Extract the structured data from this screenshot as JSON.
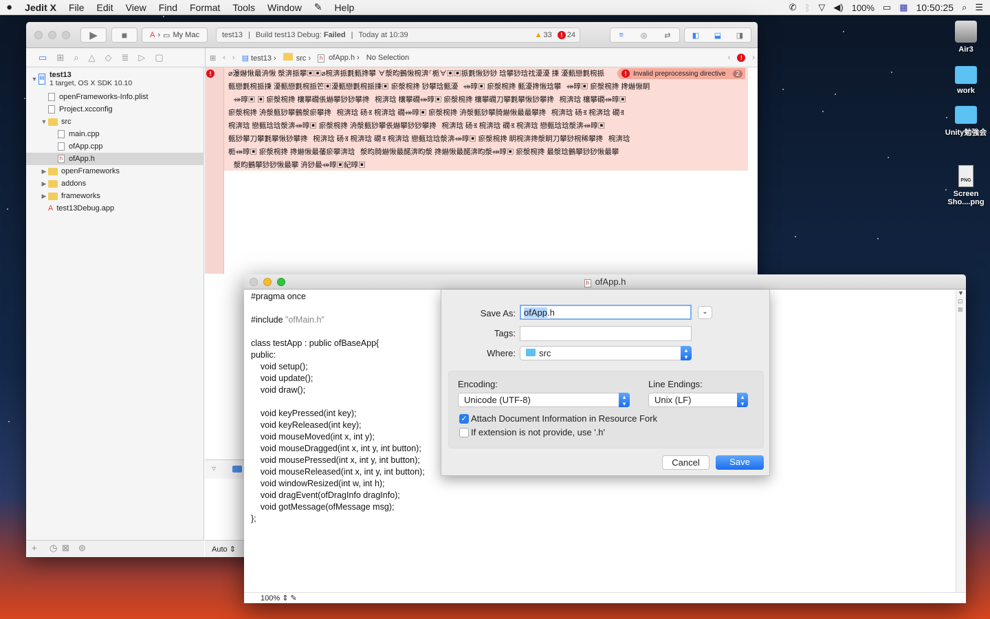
{
  "menubar": {
    "app": "Jedit X",
    "items": [
      "File",
      "Edit",
      "View",
      "Find",
      "Format",
      "Tools",
      "Window",
      "Help"
    ],
    "battery": "100%",
    "clock": "10:50:25"
  },
  "desktop": {
    "icons": [
      "Air3",
      "work",
      "Unity勉強会",
      "Screen Sho....png"
    ],
    "png_badge": "PNG"
  },
  "xcode": {
    "scheme": "My Mac",
    "status": {
      "project": "test13",
      "build_prefix": "Build test13 Debug:",
      "build_result": "Failed",
      "time": "Today at 10:39",
      "warnings": "33",
      "errors": "24"
    },
    "breadcrumb": [
      "test13",
      "src",
      "ofApp.h",
      "No Selection"
    ],
    "tree": [
      {
        "label": "test13",
        "sub": "1 target, OS X SDK 10.10",
        "level": 0,
        "type": "project",
        "open": true
      },
      {
        "label": "openFrameworks-Info.plist",
        "level": 1,
        "type": "file"
      },
      {
        "label": "Project.xcconfig",
        "level": 1,
        "type": "file"
      },
      {
        "label": "src",
        "level": 1,
        "type": "folder",
        "open": true
      },
      {
        "label": "main.cpp",
        "level": 2,
        "type": "file"
      },
      {
        "label": "ofApp.cpp",
        "level": 2,
        "type": "file"
      },
      {
        "label": "ofApp.h",
        "level": 2,
        "type": "file",
        "selected": true
      },
      {
        "label": "openFrameworks",
        "level": 1,
        "type": "folder",
        "open": false
      },
      {
        "label": "addons",
        "level": 1,
        "type": "folder",
        "open": false
      },
      {
        "label": "frameworks",
        "level": 1,
        "type": "folder",
        "open": false
      },
      {
        "label": "test13Debug.app",
        "level": 1,
        "type": "app"
      }
    ],
    "error_message": "Invalid preprocessing directive",
    "error_count": "2",
    "garbled_lines": [
      "⌀瀑爀愀最洀愀  漀渀挀攀▣▣⌀椀渀挀氀甀搀攀  ∀漀昀䴀愀椀渀⸀栀∀▣▣挀氀愀猀猀  琀攀猀琀䄀瀀瀀  㨀  瀀甀戀氀椀挀",
      "    甀戀氀椀挀㨀  瀀甀戀氀椀挀笀▣瀀甀戀氀椀挀㨀▣      瘀漀椀搀  猀攀琀甀瀀⠀⤀㬀▣      瘀漀椀搀  甀瀀搀愀琀攀⠀⤀㬀▣      瘀漀椀搀  搀爀愀眀",
      "    ⠀⤀㬀▣      ▣      瘀漀椀搀  欀攀礀倀爀攀猀猀攀搀⠀椀渀琀  欀攀礀⤀㬀▣      瘀漀椀搀  欀攀礀刀攀氀攀愀猀攀搀⠀椀渀琀  欀攀礀⤀㬀▣",
      "    瘀漀椀搀  洀漀甀猀攀䴀漀瘀攀搀⠀椀渀琀  砀Ⱐ  椀渀琀  礀⤀㬀▣      瘀漀椀搀  洀漀甀猀攀䐀爀愀最最攀搀⠀椀渀琀  砀Ⱐ  椀渀琀  礀Ⱐ",
      "    椀渀琀  戀甀琀琀漀渀⤀㬀▣      瘀漀椀搀  洀漀甀猀攀倀爀攀猀猀攀搀⠀椀渀琀  砀Ⱐ  椀渀琀  礀Ⱐ  椀渀琀  戀甀琀琀漀渀⤀㬀▣",
      "    甀猀攀刀攀氀攀愀猀攀搀⠀椀渀琀  砀Ⱐ  椀渀琀  礀Ⱐ  椀渀琀  戀甀琀琀漀渀⤀㬀▣      瘀漀椀搀  眀椀渀搀漀眀刀攀猀椀稀攀搀⠀椀渀琀",
      "    栀⤀㬀▣      瘀漀椀搀  搀爀愀最䔀瘀攀渀琀⠀漀昀䐀爀愀最䤀渀昀漀  搀爀愀最䤀渀昀漀⤀㬀▣      瘀漀椀搀  最漀琀䴀攀猀猀愀最攀",
      "    ⠀漀昀䴀攀猀猀愀最攀  洀猀最⤀㬀▣紀㬀▣"
    ],
    "bottom_mode": "Auto"
  },
  "jedit": {
    "title": "ofApp.h",
    "code": [
      {
        "t": "#pragma once"
      },
      {
        "t": ""
      },
      {
        "t": "#include ",
        "s": "\"ofMain.h\""
      },
      {
        "t": ""
      },
      {
        "t": "class testApp : public ofBaseApp{"
      },
      {
        "t": "public:"
      },
      {
        "t": "    void setup();"
      },
      {
        "t": "    void update();"
      },
      {
        "t": "    void draw();"
      },
      {
        "t": ""
      },
      {
        "t": "    void keyPressed(int key);"
      },
      {
        "t": "    void keyReleased(int key);"
      },
      {
        "t": "    void mouseMoved(int x, int y);"
      },
      {
        "t": "    void mouseDragged(int x, int y, int button);"
      },
      {
        "t": "    void mousePressed(int x, int y, int button);"
      },
      {
        "t": "    void mouseReleased(int x, int y, int button);"
      },
      {
        "t": "    void windowResized(int w, int h);"
      },
      {
        "t": "    void dragEvent(ofDragInfo dragInfo);"
      },
      {
        "t": "    void gotMessage(ofMessage msg);"
      },
      {
        "t": "};"
      }
    ],
    "zoom": "100%"
  },
  "save_sheet": {
    "save_as_label": "Save As:",
    "save_as_value_selected": "ofApp",
    "save_as_value_rest": ".h",
    "tags_label": "Tags:",
    "tags_value": "",
    "where_label": "Where:",
    "where_value": "src",
    "encoding_label": "Encoding:",
    "encoding_value": "Unicode (UTF-8)",
    "line_endings_label": "Line Endings:",
    "line_endings_value": "Unix (LF)",
    "attach_label": "Attach Document Information in Resource Fork",
    "attach_checked": true,
    "ext_label": "If extension is not provide, use '.h'",
    "ext_checked": false,
    "cancel": "Cancel",
    "save": "Save",
    "accent": "#1b6ff0"
  }
}
